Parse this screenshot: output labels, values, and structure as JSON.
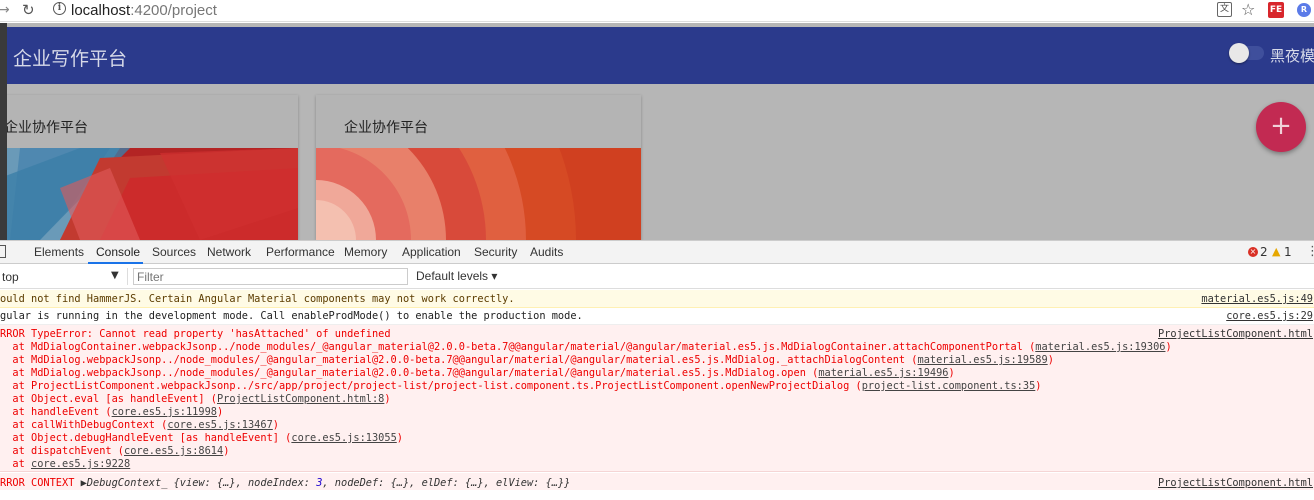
{
  "browser": {
    "url_host": "localhost",
    "url_rest": ":4200/project",
    "ext_label": "FE",
    "ext2_label": "R"
  },
  "app": {
    "title": "企业写作平台",
    "dark_mode_label": "黑夜模式",
    "fab_label": "+",
    "cards": [
      {
        "title": "企业协作平台"
      },
      {
        "title": "企业协作平台"
      }
    ]
  },
  "devtools": {
    "tabs": [
      "Elements",
      "Console",
      "Sources",
      "Network",
      "Performance",
      "Memory",
      "Application",
      "Security",
      "Audits"
    ],
    "active_tab": "Console",
    "error_count": "2",
    "warning_count": "1",
    "context": "top",
    "filter_placeholder": "Filter",
    "levels": "Default levels ▾",
    "messages": {
      "warn": {
        "text": "ould not find HammerJS. Certain Angular Material components may not work correctly.",
        "source": "material.es5.js:49"
      },
      "info": {
        "text": "gular is running in the development mode. Call enableProdMode() to enable the production mode.",
        "source": "core.es5.js:29"
      },
      "error": {
        "source": "ProjectListComponent.html",
        "header": "RROR TypeError: Cannot read property 'hasAttached' of undefined",
        "frames": [
          {
            "text": "  at MdDialogContainer.webpackJsonp../node_modules/_@angular_material@2.0.0-beta.7@@angular/material/@angular/material.es5.js.MdDialogContainer.attachComponentPortal (",
            "link": "material.es5.js:19306",
            "tail": ")"
          },
          {
            "text": "  at MdDialog.webpackJsonp../node_modules/_@angular_material@2.0.0-beta.7@@angular/material/@angular/material.es5.js.MdDialog._attachDialogContent (",
            "link": "material.es5.js:19589",
            "tail": ")"
          },
          {
            "text": "  at MdDialog.webpackJsonp../node_modules/_@angular_material@2.0.0-beta.7@@angular/material/@angular/material.es5.js.MdDialog.open (",
            "link": "material.es5.js:19496",
            "tail": ")"
          },
          {
            "text": "  at ProjectListComponent.webpackJsonp../src/app/project/project-list/project-list.component.ts.ProjectListComponent.openNewProjectDialog (",
            "link": "project-list.component.ts:35",
            "tail": ")"
          },
          {
            "text": "  at Object.eval [as handleEvent] (",
            "link": "ProjectListComponent.html:8",
            "tail": ")"
          },
          {
            "text": "  at handleEvent (",
            "link": "core.es5.js:11998",
            "tail": ")"
          },
          {
            "text": "  at callWithDebugContext (",
            "link": "core.es5.js:13467",
            "tail": ")"
          },
          {
            "text": "  at Object.debugHandleEvent [as handleEvent] (",
            "link": "core.es5.js:13055",
            "tail": ")"
          },
          {
            "text": "  at dispatchEvent (",
            "link": "core.es5.js:8614",
            "tail": ")"
          },
          {
            "text": "  at ",
            "link": "core.es5.js:9228",
            "tail": ""
          }
        ]
      },
      "error2": {
        "prefix": "RROR CONTEXT ",
        "arrow": "▶",
        "obj": "DebugContext_",
        "body_a": " {view: {…}, nodeIndex: ",
        "num": "3",
        "body_b": ", nodeDef: {…}, elDef: {…}, elView: {…}}",
        "source": "ProjectListComponent.html"
      }
    }
  },
  "colors": {
    "toolbar": "#2b3a8c",
    "fab": "#c22a52",
    "error_text": "#e00000"
  }
}
